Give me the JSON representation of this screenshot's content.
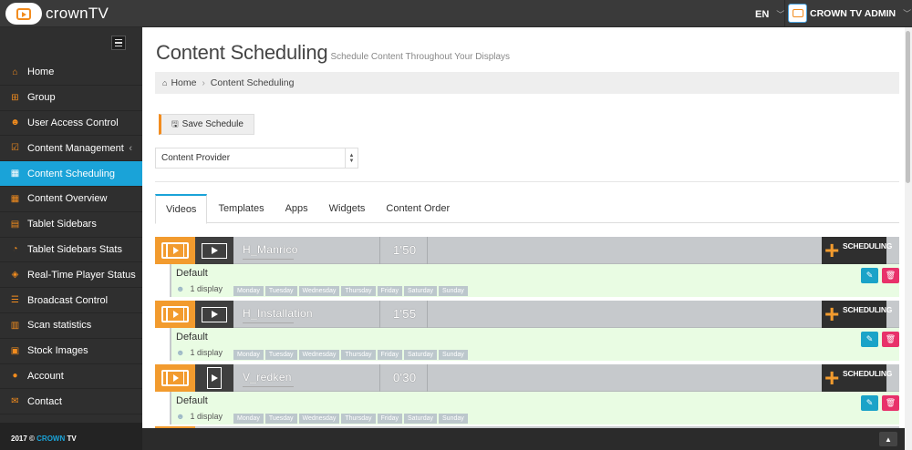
{
  "app": {
    "logo_text": "crownTV",
    "language": "EN",
    "user": "CROWN TV ADMIN",
    "footer_year": "2017 ©",
    "footer_brand": "CROWN",
    "footer_tail": "TV"
  },
  "sidebar": {
    "items": [
      {
        "label": "Home",
        "icon": "home-icon"
      },
      {
        "label": "Group",
        "icon": "sitemap-icon"
      },
      {
        "label": "User Access Control",
        "icon": "users-icon"
      },
      {
        "label": "Content Management",
        "icon": "checkbox-icon",
        "caret": "‹"
      },
      {
        "label": "Content Scheduling",
        "icon": "calendar-icon",
        "active": true
      },
      {
        "label": "Content Overview",
        "icon": "calendar-icon"
      },
      {
        "label": "Tablet Sidebars",
        "icon": "table-icon"
      },
      {
        "label": "Tablet Sidebars Stats",
        "icon": "pie-chart-icon"
      },
      {
        "label": "Real-Time Player Status",
        "icon": "cube-icon"
      },
      {
        "label": "Broadcast Control",
        "icon": "list-icon"
      },
      {
        "label": "Scan statistics",
        "icon": "bar-chart-icon"
      },
      {
        "label": "Stock Images",
        "icon": "image-icon"
      },
      {
        "label": "Account",
        "icon": "user-icon"
      },
      {
        "label": "Contact",
        "icon": "envelope-icon"
      }
    ]
  },
  "header": {
    "title": "Content Scheduling",
    "subtitle": "Schedule Content Throughout Your Displays"
  },
  "breadcrumb": {
    "home": "Home",
    "current": "Content Scheduling"
  },
  "toolbar": {
    "save_label": "Save Schedule"
  },
  "provider_select": {
    "value": "Content Provider"
  },
  "tabs": [
    {
      "label": "Videos",
      "active": true
    },
    {
      "label": "Templates"
    },
    {
      "label": "Apps"
    },
    {
      "label": "Widgets"
    },
    {
      "label": "Content Order"
    }
  ],
  "schedule_label": "SCHEDULING",
  "videos": [
    {
      "title": "H_Manrico",
      "duration": "1'50",
      "schedule_name": "Default",
      "displays": "1 display",
      "days": [
        "Monday",
        "Tuesday",
        "Wednesday",
        "Thursday",
        "Friday",
        "Saturday",
        "Sunday"
      ]
    },
    {
      "title": "H_Installation",
      "duration": "1'55",
      "schedule_name": "Default",
      "displays": "1 display",
      "days": [
        "Monday",
        "Tuesday",
        "Wednesday",
        "Thursday",
        "Friday",
        "Saturday",
        "Sunday"
      ]
    },
    {
      "title": "V_redken",
      "duration": "0'30",
      "schedule_name": "Default",
      "displays": "1 display",
      "days": [
        "Monday",
        "Tuesday",
        "Wednesday",
        "Thursday",
        "Friday",
        "Saturday",
        "Sunday"
      ],
      "portrait": true
    }
  ]
}
